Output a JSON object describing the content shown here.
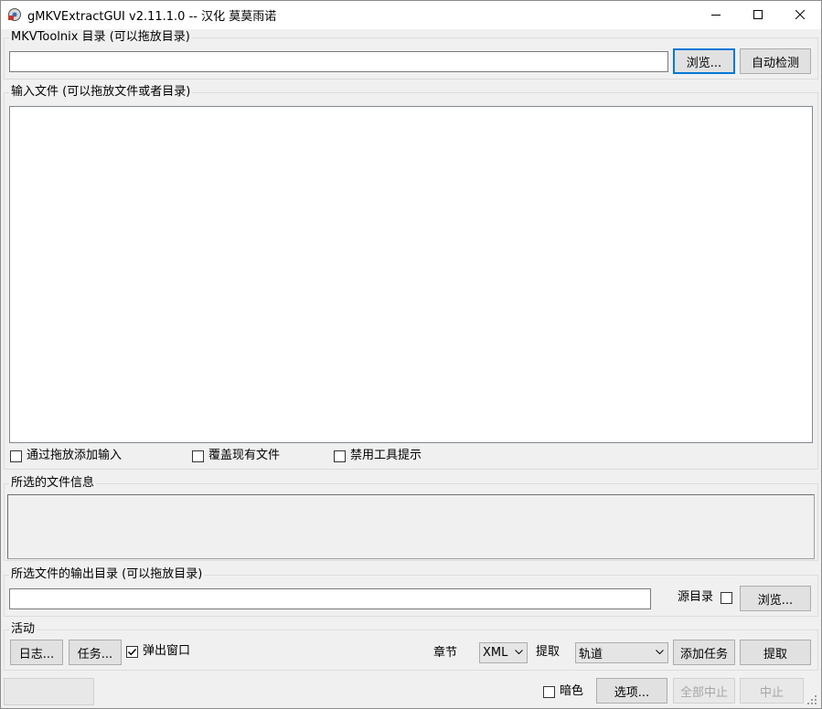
{
  "window": {
    "title": "gMKVExtractGUI v2.11.1.0 -- 汉化 莫莫雨诺"
  },
  "mkvtoolnix": {
    "group_label": "MKVToolnix 目录 (可以拖放目录)",
    "path_value": "",
    "browse_label": "浏览...",
    "auto_detect_label": "自动检测"
  },
  "input": {
    "group_label": "输入文件 (可以拖放文件或者目录)",
    "options": [
      {
        "label": "通过拖放添加输入",
        "checked": false
      },
      {
        "label": "覆盖现有文件",
        "checked": false
      },
      {
        "label": "禁用工具提示",
        "checked": false
      }
    ]
  },
  "file_info": {
    "group_label": "所选的文件信息",
    "content": ""
  },
  "output": {
    "group_label": "所选文件的输出目录 (可以拖放目录)",
    "path_value": "",
    "source_dir_label": "源目录",
    "source_dir_checked": false,
    "browse_label": "浏览..."
  },
  "actions": {
    "group_label": "活动",
    "log_label": "日志...",
    "jobs_label": "任务...",
    "popup_label": "弹出窗口",
    "popup_checked": true,
    "chapter_label": "章节",
    "chapter_value": "XML",
    "extract_label": "提取",
    "extract_value": "轨道",
    "add_job_label": "添加任务",
    "extract_button_label": "提取"
  },
  "statusbar": {
    "dark_label": "暗色",
    "dark_checked": false,
    "options_label": "选项...",
    "abort_all_label": "全部中止",
    "abort_label": "中止"
  }
}
